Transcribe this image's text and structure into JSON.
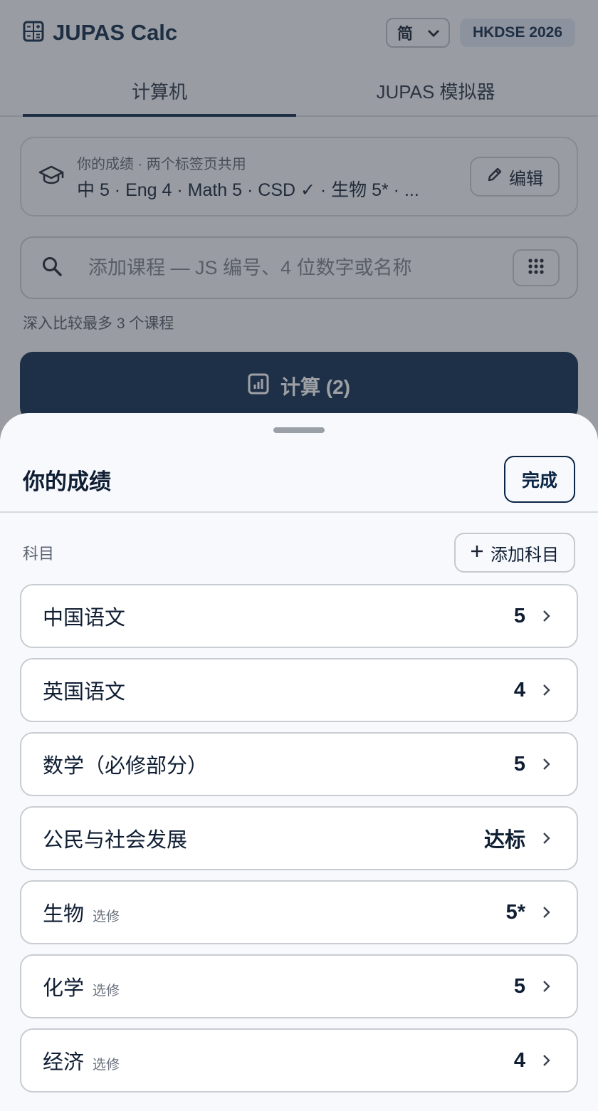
{
  "app": {
    "title": "JUPAS Calc",
    "language": "简",
    "year_badge": "HKDSE 2026"
  },
  "tabs": [
    {
      "label": "计算机",
      "active": true
    },
    {
      "label": "JUPAS 模拟器",
      "active": false
    }
  ],
  "grades_card": {
    "caption": "你的成绩 · 两个标签页共用",
    "summary": "中 5 · Eng 4 · Math 5 · CSD ✓ · 生物 5* · ...",
    "edit_label": "编辑"
  },
  "search": {
    "placeholder": "添加课程 — JS 编号、4 位数字或名称"
  },
  "compare_hint": "深入比较最多 3 个课程",
  "calculate_label": "计算 (2)",
  "sheet": {
    "title": "你的成绩",
    "done_label": "完成",
    "section_label": "科目",
    "add_subject_label": "添加科目",
    "subjects": [
      {
        "name": "中国语文",
        "tag": "",
        "grade": "5"
      },
      {
        "name": "英国语文",
        "tag": "",
        "grade": "4"
      },
      {
        "name": "数学（必修部分）",
        "tag": "",
        "grade": "5"
      },
      {
        "name": "公民与社会发展",
        "tag": "",
        "grade": "达标"
      },
      {
        "name": "生物",
        "tag": "选修",
        "grade": "5*"
      },
      {
        "name": "化学",
        "tag": "选修",
        "grade": "5"
      },
      {
        "name": "经济",
        "tag": "选修",
        "grade": "4"
      }
    ]
  },
  "colors": {
    "primary": "#0a2a4f",
    "badge_bg": "#dfe6f3",
    "sheet_bg": "#f7f9fd"
  }
}
